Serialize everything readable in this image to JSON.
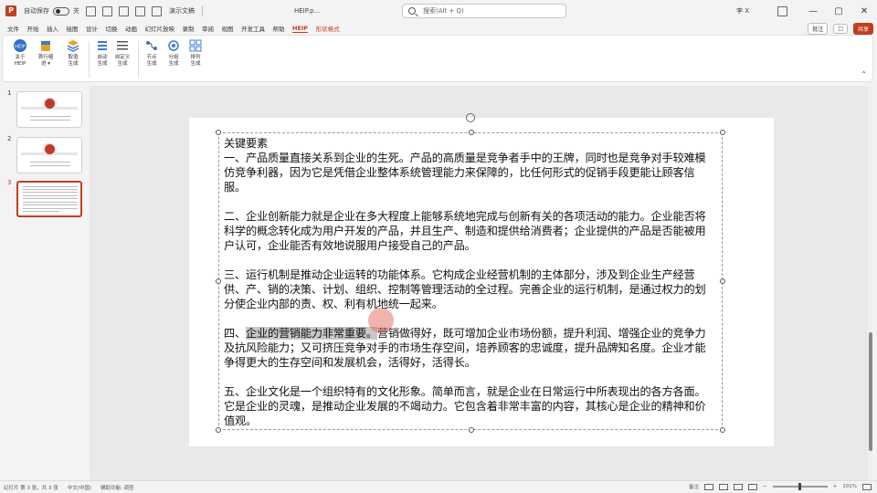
{
  "titlebar": {
    "autosave_label": "自动保存",
    "autosave_state": "关",
    "file_name": "演示文稿",
    "file_name2": "HEIP.p...",
    "search_placeholder": "搜索(Alt + Q)",
    "user": "李 X",
    "minimize": "—",
    "restore": "▢",
    "close": "✕"
  },
  "menu": {
    "items": [
      "文件",
      "开始",
      "插入",
      "绘图",
      "设计",
      "切换",
      "动画",
      "幻灯片放映",
      "录制",
      "审阅",
      "视图",
      "开发工具",
      "帮助",
      "HEIP",
      "形状格式"
    ],
    "active_index": 13,
    "context_index": 14,
    "comments_label": "批注",
    "present_label": "□",
    "share_label": "共享"
  },
  "ribbon": {
    "buttons": [
      {
        "label1": "关于",
        "label2": "HEIP",
        "icon": "heip-logo-icon"
      },
      {
        "label1": "首行缩",
        "label2": "进 ▾",
        "icon": "cup-icon"
      },
      {
        "label1": "取值",
        "label2": "生成",
        "icon": "stack-icon"
      },
      {
        "label1": "自动",
        "label2": "生成",
        "icon": "list-icon"
      },
      {
        "label1": "自定义",
        "label2": "生成",
        "icon": "lines-icon"
      },
      {
        "label1": "节点",
        "label2": "生成",
        "icon": "nodes-icon"
      },
      {
        "label1": "分组",
        "label2": "生成",
        "icon": "group-icon"
      },
      {
        "label1": "排列",
        "label2": "生成",
        "icon": "grid-icon"
      }
    ]
  },
  "thumbnails": [
    {
      "num": "1"
    },
    {
      "num": "2"
    },
    {
      "num": "3"
    }
  ],
  "slide": {
    "heading": "关键要素",
    "para1": "一、产品质量直接关系到企业的生死。产品的高质量是竞争者手中的王牌，同时也是竞争对手较难模仿竞争利器，因为它是凭借企业整体系统管理能力来保障的，比任何形式的促销手段更能让顾客信服。",
    "para2": "二、企业创新能力就是企业在多大程度上能够系统地完成与创新有关的各项活动的能力。企业能否将科学的概念转化成为用户开发的产品，并且生产、制造和提供给消费者；企业提供的产品是否能被用户认可，企业能否有效地说服用户接受自己的产品。",
    "para3": "三、运行机制是推动企业运转的功能体系。它构成企业经营机制的主体部分，涉及到企业生产经营供、产、销的决策、计划、组织、控制等管理活动的全过程。完善企业的运行机制，是通过权力的划分使企业内部的责、权、利有机地统一起来。",
    "para4_prefix": "四、",
    "para4_highlight": "企业的营销能力非常重要。",
    "para4_rest": "营销做得好，既可增加企业市场份额，提升利润、增强企业的竞争力及抗风险能力；又可挤压竞争对手的市场生存空间，培养顾客的忠诚度，提升品牌知名度。企业才能争得更大的生存空间和发展机会，活得好，活得长。",
    "para5": "五、企业文化是一个组织特有的文化形象。简单而言，就是企业在日常运行中所表现出的各方各面。它是企业的灵魂，是推动企业发展的不竭动力。它包含着非常丰富的内容，其核心是企业的精神和价值观。"
  },
  "status": {
    "slide_info": "幻灯片 第 3 张，共 3 张",
    "language": "中文(中国)",
    "accessibility": "辅助功能: 调查",
    "notes": "备注",
    "zoom": "101%"
  }
}
